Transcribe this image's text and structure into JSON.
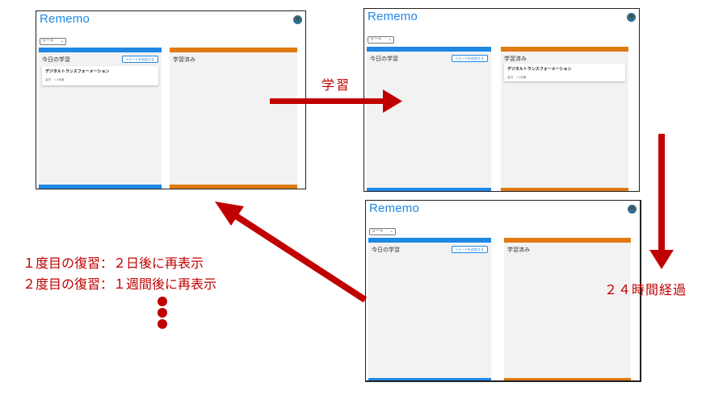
{
  "app": {
    "title": "Rememo",
    "sort_label": "ソート"
  },
  "columns": {
    "today_label": "今日の学習",
    "done_label": "学習済み",
    "add_card_label": "+カードを追加する",
    "today_color": "#1e88e5",
    "done_color": "#e07b12"
  },
  "card": {
    "title": "デジタルトランスフォーメーション",
    "meta": "名付　☆1日後"
  },
  "diagram": {
    "study_label": "学習",
    "elapsed_label": "２４時間経過",
    "review_notes": [
      "１度目の復習：２日後に再表示",
      "２度目の復習：１週間後に再表示"
    ],
    "arrow_color": "#c00000",
    "continuation": "vertical-ellipsis-dots"
  }
}
